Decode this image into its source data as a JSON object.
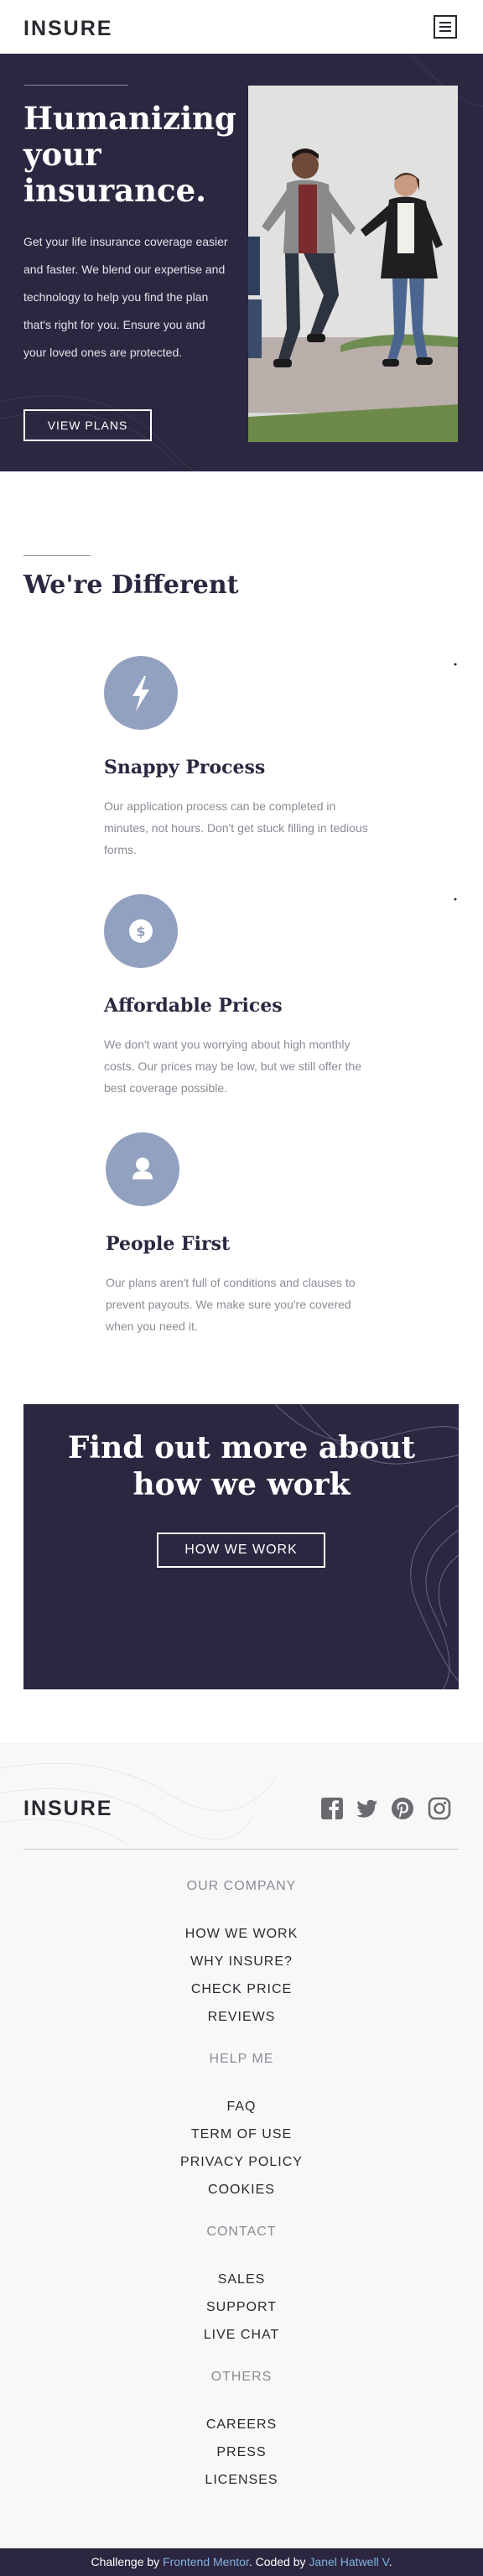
{
  "header": {
    "logo": "INSURE",
    "menu_icon": "hamburger-icon"
  },
  "hero": {
    "title": "Humanizing your insurance.",
    "text": "Get your life insurance coverage easier and faster. We blend our expertise and technology to help you find the plan that's right for you. Ensure you and your loved ones are protected.",
    "button": "VIEW PLANS"
  },
  "different": {
    "title": "We're Different",
    "features": [
      {
        "icon": "lightning-icon",
        "title": "Snappy Process",
        "text": "Our application process can be completed in minutes, not hours. Don't get stuck filling in tedious forms."
      },
      {
        "icon": "dollar-icon",
        "title": "Affordable Prices",
        "text": "We don't want you worrying about high monthly costs. Our prices may be low, but we still offer the best coverage possible."
      },
      {
        "icon": "person-icon",
        "title": "People First",
        "text": "Our plans aren't full of conditions and clauses to prevent payouts. We make sure you're covered when you need it."
      }
    ]
  },
  "cta": {
    "title": "Find out more about how we work",
    "button": "HOW WE WORK"
  },
  "footer": {
    "logo": "INSURE",
    "socials": [
      "facebook-icon",
      "twitter-icon",
      "pinterest-icon",
      "instagram-icon"
    ],
    "groups": [
      {
        "heading": "OUR COMPANY",
        "links": [
          "HOW WE WORK",
          "WHY INSURE?",
          "CHECK PRICE",
          "REVIEWS"
        ]
      },
      {
        "heading": "HELP ME",
        "links": [
          "FAQ",
          "TERM OF USE",
          "PRIVACY POLICY",
          "COOKIES"
        ]
      },
      {
        "heading": "CONTACT",
        "links": [
          "SALES",
          "SUPPORT",
          "LIVE CHAT"
        ]
      },
      {
        "heading": "OTHERS",
        "links": [
          "CAREERS",
          "PRESS",
          "LICENSES"
        ]
      }
    ]
  },
  "credits": {
    "prefix": "Challenge by ",
    "mentor": "Frontend Mentor",
    "middle": ". Coded by ",
    "author": "Janel Hatwell V",
    "suffix": "."
  },
  "colors": {
    "dark_violet": "#2c2640",
    "grayish_blue": "#93a1c0",
    "footer_bg": "#f8f8f8"
  }
}
